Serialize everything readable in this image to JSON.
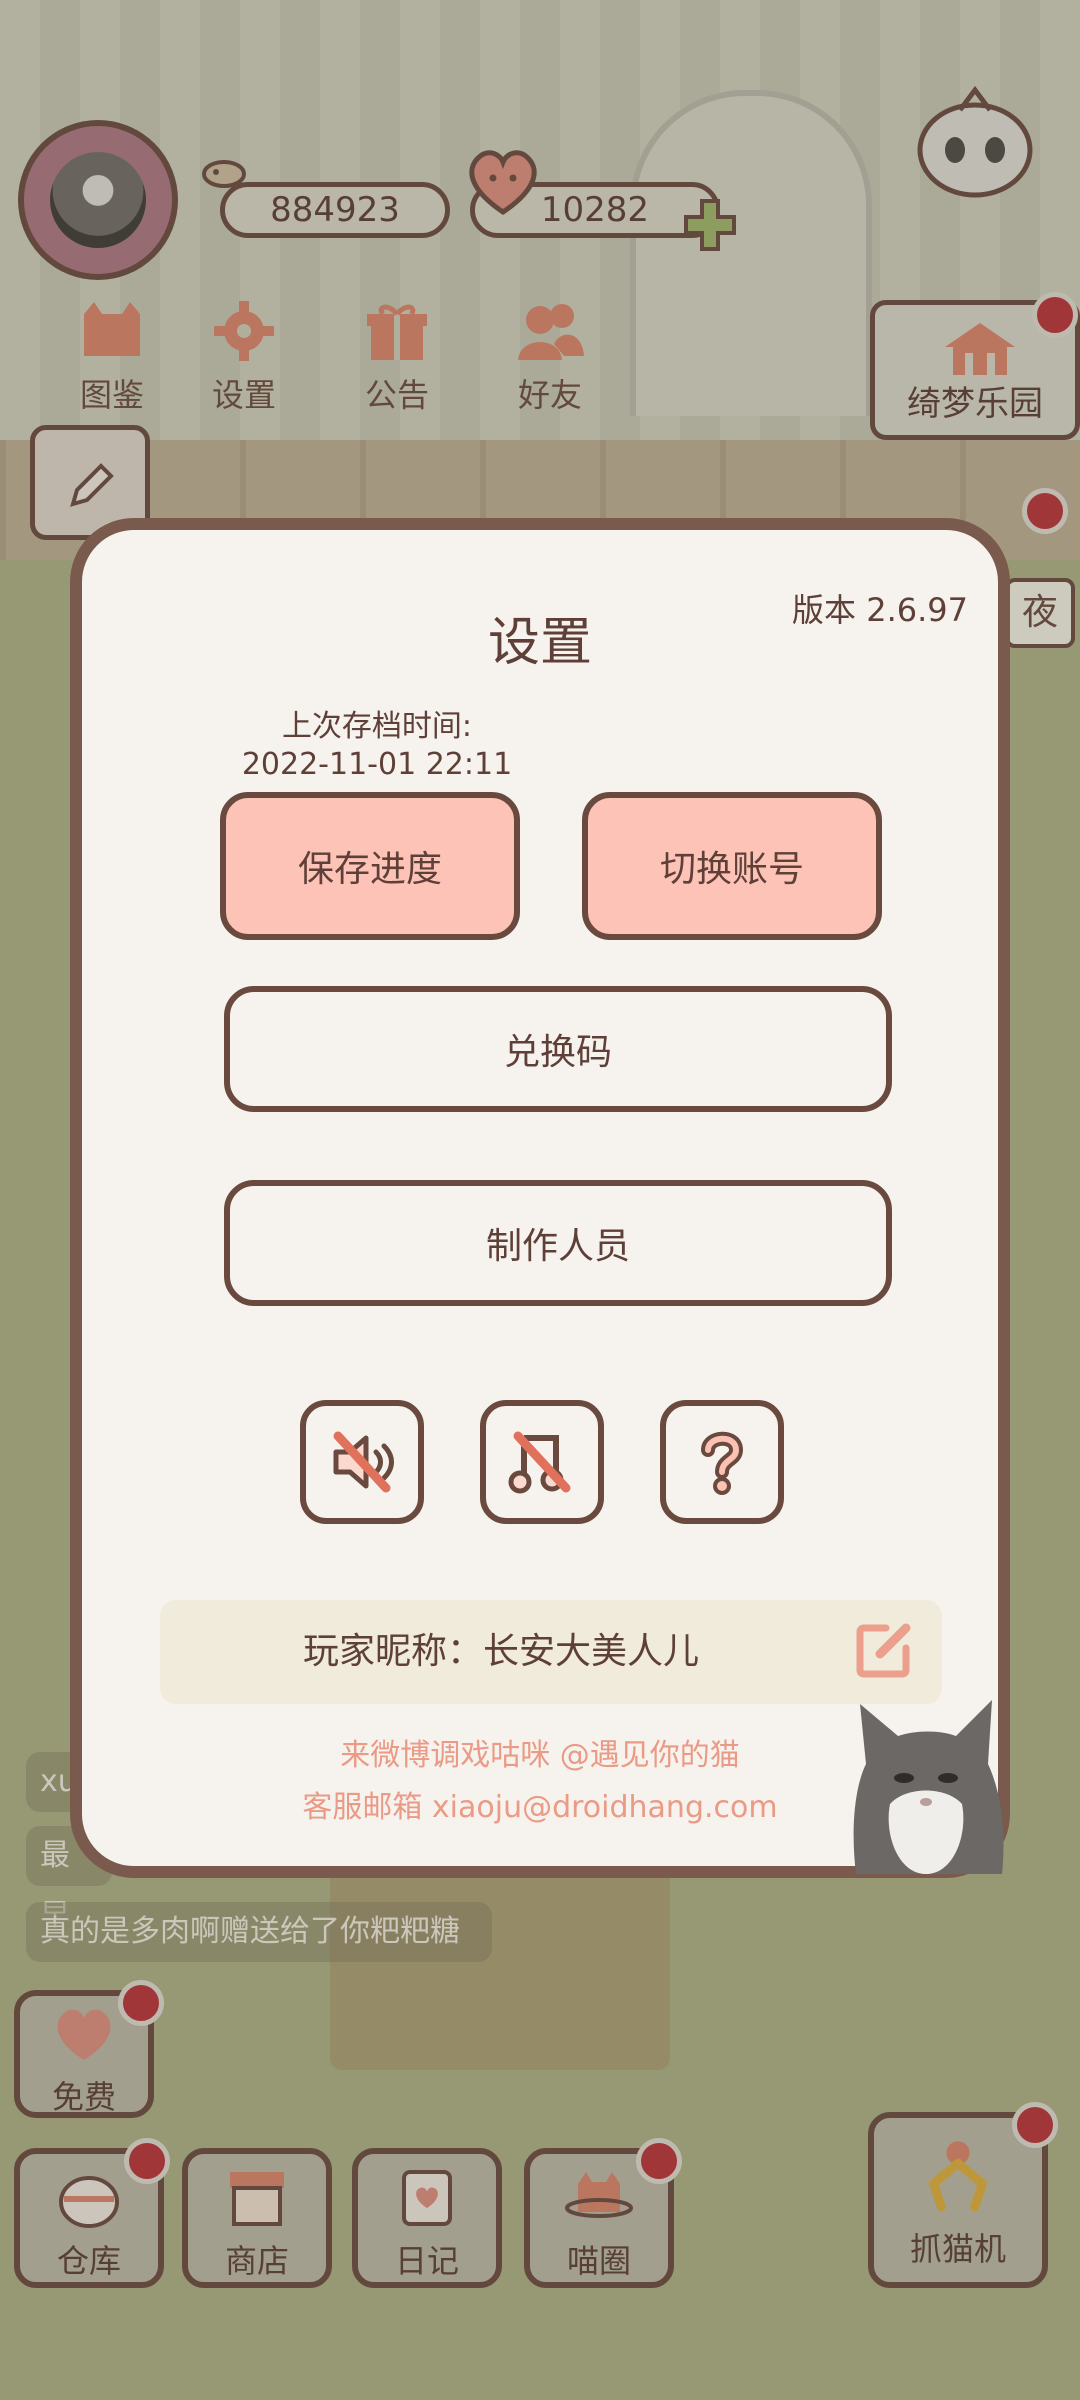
{
  "hud": {
    "coins": "884923",
    "hearts": "10282"
  },
  "top_menu": [
    {
      "label": "图鉴",
      "icon": "cat-book-icon"
    },
    {
      "label": "设置",
      "icon": "gear-icon"
    },
    {
      "label": "公告",
      "icon": "gift-icon"
    },
    {
      "label": "好友",
      "icon": "friends-icon"
    }
  ],
  "side": {
    "dream_park": "绮梦乐园",
    "night": "夜"
  },
  "chat": {
    "line1": "xu",
    "line2": "最早",
    "line3": "真的是多肉啊赠送给了你粑粑糖"
  },
  "bottom_bar": {
    "free": "免费",
    "warehouse": "仓库",
    "shop": "商店",
    "diary": "日记",
    "circle": "喵圈",
    "claw": "抓猫机"
  },
  "dialog": {
    "title": "设置",
    "version": "版本 2.6.97",
    "save_time_label": "上次存档时间:",
    "save_time_value": "2022-11-01 22:11",
    "save_button": "保存进度",
    "switch_button": "切换账号",
    "redeem_button": "兑换码",
    "credits_button": "制作人员",
    "nickname": "玩家昵称：长安大美人儿",
    "weibo": "来微博调戏咕咪 @遇见你的猫",
    "email": "客服邮箱 xiaoju@droidhang.com"
  },
  "colors": {
    "accent_pink": "#fec3b7",
    "border_brown": "#6a4a3f",
    "link_salmon": "#ea9a85",
    "badge_red": "#b5333a"
  }
}
